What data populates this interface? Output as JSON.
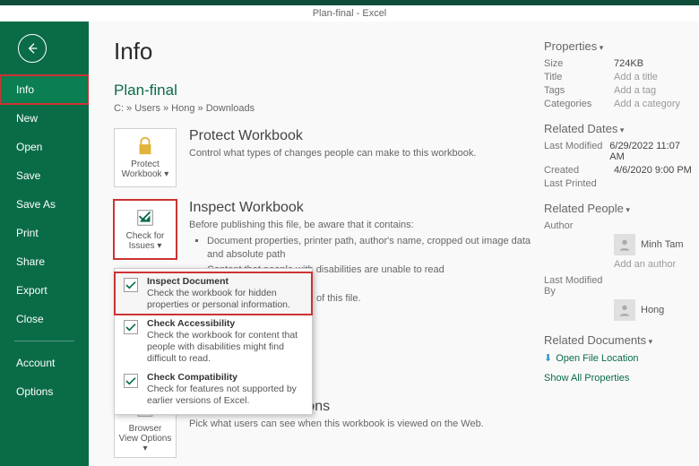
{
  "title_bar": "Plan-final - Excel",
  "nav": {
    "items": [
      "Info",
      "New",
      "Open",
      "Save",
      "Save As",
      "Print",
      "Share",
      "Export",
      "Close"
    ],
    "bottom": [
      "Account",
      "Options"
    ],
    "selected_index": 0
  },
  "pane_title": "Info",
  "doc": {
    "name": "Plan-final",
    "path": "C: » Users » Hong » Downloads"
  },
  "protect": {
    "btn": "Protect Workbook ▾",
    "heading": "Protect Workbook",
    "desc": "Control what types of changes people can make to this workbook."
  },
  "inspect": {
    "btn": "Check for Issues ▾",
    "heading": "Inspect Workbook",
    "intro": "Before publishing this file, be aware that it contains:",
    "bullets": [
      "Document properties, printer path, author's name, cropped out image data and absolute path",
      "Content that people with disabilities are unable to read"
    ]
  },
  "menu": {
    "items": [
      {
        "title": "Inspect Document",
        "desc": "Check the workbook for hidden properties or personal information."
      },
      {
        "title": "Check Accessibility",
        "desc": "Check the workbook for content that people with disabilities might find difficult to read."
      },
      {
        "title": "Check Compatibility",
        "desc": "Check for features not supported by earlier versions of Excel."
      }
    ],
    "extra_visible": "of this file."
  },
  "browser": {
    "btn": "Browser View Options ▾",
    "heading": "Browser View Options",
    "desc": "Pick what users can see when this workbook is viewed on the Web."
  },
  "props": {
    "heading": "Properties",
    "rows": [
      {
        "k": "Size",
        "v": "724KB"
      },
      {
        "k": "Title",
        "v": "Add a title",
        "empty": true
      },
      {
        "k": "Tags",
        "v": "Add a tag",
        "empty": true
      },
      {
        "k": "Categories",
        "v": "Add a category",
        "empty": true
      }
    ]
  },
  "dates": {
    "heading": "Related Dates",
    "rows": [
      {
        "k": "Last Modified",
        "v": "6/29/2022 11:07 AM"
      },
      {
        "k": "Created",
        "v": "4/6/2020 9:00 PM"
      },
      {
        "k": "Last Printed",
        "v": ""
      }
    ]
  },
  "people": {
    "heading": "Related People",
    "author_label": "Author",
    "author": "Minh Tam",
    "add_author": "Add an author",
    "modby_label": "Last Modified By",
    "modby": "Hong"
  },
  "related": {
    "heading": "Related Documents",
    "open_loc": "Open File Location",
    "show_all": "Show All Properties"
  }
}
